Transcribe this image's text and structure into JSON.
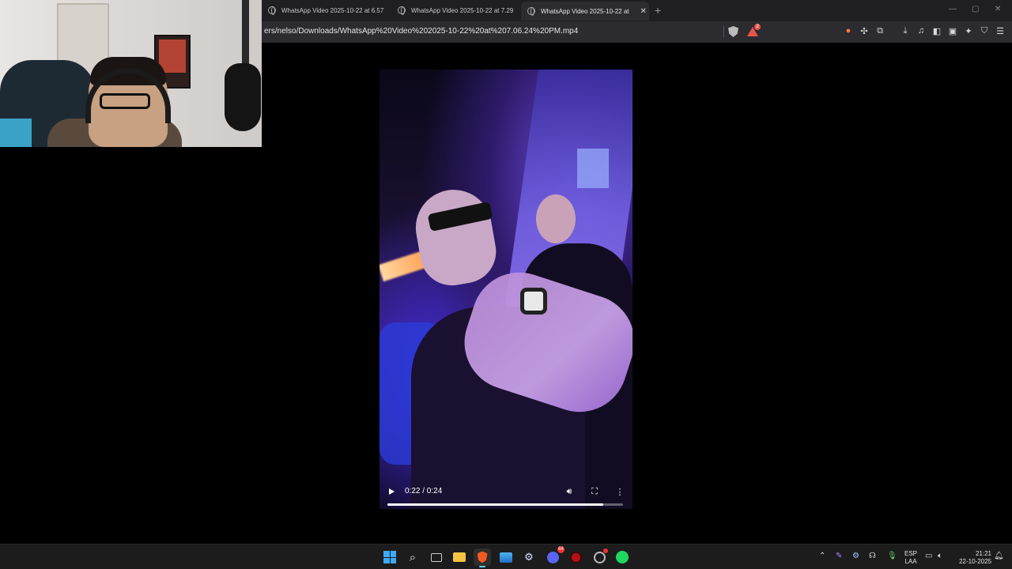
{
  "browser": {
    "tabs": [
      {
        "label": "WhatsApp Video 2025-10-22 at 6.57",
        "active": false
      },
      {
        "label": "WhatsApp Video 2025-10-22 at 7.29",
        "active": false
      },
      {
        "label": "WhatsApp Video 2025-10-22 at",
        "active": true
      }
    ],
    "url": "ers/nelso/Downloads/WhatsApp%20Video%202025-10-22%20at%207.06.24%20PM.mp4",
    "rewards_badge": "2",
    "new_tab_icon": "+"
  },
  "video": {
    "time_label": "0:22 / 0:24",
    "progress": 0.917
  },
  "taskbar": {
    "language": "ESP",
    "layout": "LAA",
    "time": "21:21",
    "date": "22-10-2025",
    "discord_badge": "64"
  },
  "colors": {
    "browser_bg": "#1f1f23",
    "address_bg": "#2b2b30",
    "taskbar_bg": "#1c1c1c",
    "accent": "#60cdff"
  }
}
